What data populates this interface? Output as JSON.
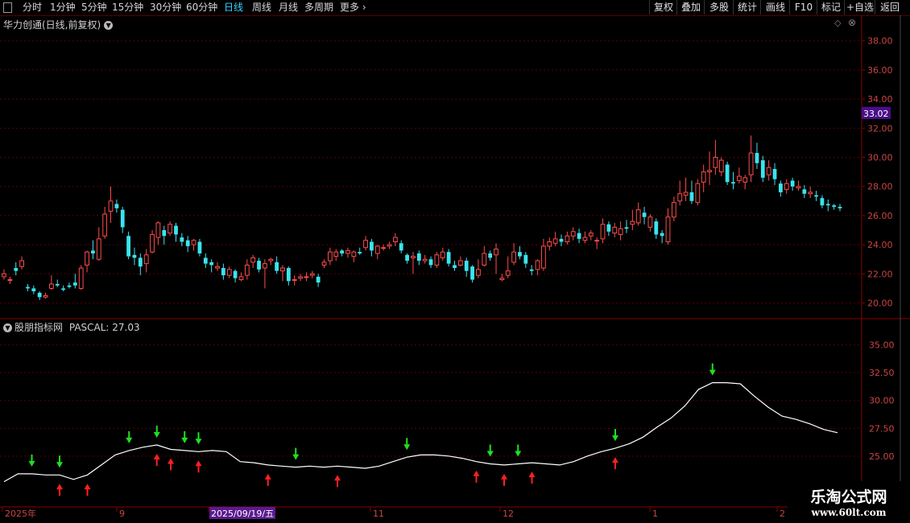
{
  "toolbar": {
    "periods": [
      "分时",
      "1分钟",
      "5分钟",
      "15分钟",
      "30分钟",
      "60分钟",
      "日线",
      "周线",
      "月线",
      "多周期",
      "更多"
    ],
    "active_period": "日线",
    "right_buttons": [
      "复权",
      "叠加",
      "多股",
      "统计",
      "画线",
      "F10",
      "标记",
      "+自选",
      "返回"
    ]
  },
  "main_chart": {
    "title": "华力创通(日线,前复权)",
    "current_price": "33.02",
    "price_ticks": [
      "38.00",
      "36.00",
      "34.00",
      "32.00",
      "30.00",
      "28.00",
      "26.00",
      "24.00",
      "22.00",
      "20.00"
    ],
    "up_color": "#ff4c4c",
    "down_color": "#3ae4ee"
  },
  "indicator": {
    "title": "股朋指标网",
    "value_label": "PASCAL: 27.03",
    "ticks": [
      "35.00",
      "32.50",
      "30.00",
      "27.50",
      "25.00"
    ],
    "line_color": "#ffffff",
    "buy_color": "#ff2020",
    "sell_color": "#20e020"
  },
  "xaxis": {
    "labels": [
      "2025年",
      "9",
      "2025/09/19/五",
      "11",
      "12",
      "1",
      "2"
    ]
  },
  "watermark": {
    "line1": "乐淘公式网",
    "line2": "www.60lt.com"
  },
  "chart_data": {
    "type": "candlestick",
    "price_axis": {
      "range": [
        19.2,
        39.2
      ],
      "ticks": [
        20,
        22,
        24,
        26,
        28,
        30,
        32,
        34,
        36,
        38
      ]
    },
    "indicator_axis": {
      "range": [
        20.5,
        37.0
      ],
      "ticks": [
        25,
        27.5,
        30,
        32.5,
        35
      ]
    },
    "pascal_line": [
      22.7,
      23.4,
      23.4,
      23.3,
      23.3,
      22.9,
      23.3,
      24.2,
      25.1,
      25.5,
      25.8,
      26.0,
      25.6,
      25.5,
      25.4,
      25.5,
      25.4,
      24.5,
      24.4,
      24.2,
      24.1,
      24.0,
      24.1,
      24.0,
      24.1,
      24.0,
      23.9,
      24.1,
      24.5,
      24.9,
      25.1,
      25.1,
      25.0,
      24.8,
      24.5,
      24.3,
      24.2,
      24.3,
      24.4,
      24.3,
      24.2,
      24.5,
      25.0,
      25.4,
      25.7,
      26.1,
      26.7,
      27.6,
      28.4,
      29.5,
      31.0,
      31.6,
      31.6,
      31.5,
      30.4,
      29.4,
      28.6,
      28.3,
      27.9,
      27.4,
      27.1
    ],
    "candles": [
      [
        21.8,
        22.0,
        22.3,
        21.6
      ],
      [
        21.6,
        21.6,
        21.8,
        21.3
      ],
      [
        22.4,
        22.2,
        22.8,
        21.9
      ],
      [
        22.5,
        22.9,
        23.2,
        22.3
      ],
      [
        21.1,
        21.0,
        21.3,
        20.8
      ],
      [
        21.0,
        20.8,
        21.2,
        20.6
      ],
      [
        20.7,
        20.4,
        20.8,
        20.2
      ],
      [
        20.4,
        20.5,
        20.7,
        20.3
      ],
      [
        21.0,
        21.3,
        21.9,
        20.9
      ],
      [
        21.3,
        21.2,
        21.6,
        21.1
      ],
      [
        21.0,
        20.9,
        21.2,
        20.8
      ],
      [
        21.2,
        21.1,
        21.4,
        21.0
      ],
      [
        21.4,
        21.2,
        22.0,
        21.0
      ],
      [
        21.0,
        22.4,
        22.6,
        20.9
      ],
      [
        22.6,
        23.5,
        23.6,
        22.1
      ],
      [
        23.6,
        23.4,
        24.3,
        23.0
      ],
      [
        23.0,
        24.4,
        25.2,
        22.9
      ],
      [
        24.6,
        26.1,
        26.6,
        24.4
      ],
      [
        26.3,
        27.0,
        28.0,
        25.5
      ],
      [
        26.8,
        26.5,
        27.1,
        26.2
      ],
      [
        26.4,
        25.2,
        26.6,
        24.8
      ],
      [
        24.6,
        23.2,
        24.9,
        23.0
      ],
      [
        23.3,
        23.1,
        23.8,
        22.6
      ],
      [
        23.1,
        22.5,
        23.4,
        21.9
      ],
      [
        22.7,
        23.3,
        23.7,
        22.1
      ],
      [
        23.5,
        24.7,
        25.0,
        23.4
      ],
      [
        24.5,
        25.5,
        25.6,
        24.0
      ],
      [
        25.0,
        24.6,
        25.3,
        24.0
      ],
      [
        24.8,
        25.4,
        25.6,
        24.6
      ],
      [
        25.3,
        24.7,
        25.5,
        24.2
      ],
      [
        24.5,
        24.2,
        24.8,
        23.9
      ],
      [
        24.3,
        23.9,
        24.6,
        23.5
      ],
      [
        24.0,
        24.3,
        24.4,
        23.6
      ],
      [
        24.2,
        23.4,
        24.4,
        23.2
      ],
      [
        23.1,
        22.7,
        23.4,
        22.4
      ],
      [
        22.8,
        22.6,
        23.0,
        22.1
      ],
      [
        22.4,
        22.5,
        22.8,
        22.2
      ],
      [
        22.4,
        21.9,
        22.7,
        21.6
      ],
      [
        21.9,
        22.3,
        22.5,
        21.7
      ],
      [
        22.2,
        21.7,
        22.3,
        21.4
      ],
      [
        21.6,
        21.8,
        22.1,
        21.5
      ],
      [
        21.9,
        22.6,
        23.0,
        21.6
      ],
      [
        22.8,
        23.1,
        23.3,
        22.4
      ],
      [
        22.9,
        22.3,
        23.1,
        22.1
      ],
      [
        22.4,
        22.7,
        23.0,
        21.0
      ],
      [
        22.9,
        23.0,
        23.1,
        22.6
      ],
      [
        22.8,
        22.2,
        23.2,
        22.0
      ],
      [
        22.2,
        22.4,
        22.6,
        21.5
      ],
      [
        22.4,
        21.5,
        22.5,
        21.2
      ],
      [
        21.6,
        21.6,
        21.9,
        21.2
      ],
      [
        21.7,
        21.8,
        22.0,
        21.5
      ],
      [
        21.8,
        21.8,
        22.1,
        21.5
      ],
      [
        21.9,
        22.0,
        22.2,
        21.7
      ],
      [
        21.8,
        21.4,
        22.0,
        21.1
      ],
      [
        22.6,
        22.8,
        23.0,
        22.4
      ],
      [
        22.9,
        23.5,
        23.8,
        22.6
      ],
      [
        23.2,
        23.5,
        23.7,
        22.9
      ],
      [
        23.6,
        23.4,
        23.7,
        23.2
      ],
      [
        23.4,
        23.6,
        23.8,
        23.1
      ],
      [
        23.2,
        23.5,
        23.6,
        22.8
      ],
      [
        23.5,
        23.4,
        23.8,
        23.3
      ],
      [
        23.8,
        24.3,
        24.6,
        23.6
      ],
      [
        24.2,
        23.6,
        24.4,
        23.2
      ],
      [
        23.4,
        23.9,
        24.0,
        23.0
      ],
      [
        23.8,
        23.8,
        24.0,
        23.6
      ],
      [
        23.9,
        24.0,
        24.2,
        23.7
      ],
      [
        24.2,
        24.5,
        24.8,
        23.9
      ],
      [
        24.1,
        23.6,
        24.3,
        23.4
      ],
      [
        23.3,
        22.9,
        23.4,
        22.7
      ],
      [
        23.1,
        23.2,
        23.5,
        22.0
      ],
      [
        23.4,
        22.9,
        23.6,
        22.6
      ],
      [
        22.9,
        23.0,
        23.3,
        22.7
      ],
      [
        23.0,
        22.6,
        23.2,
        22.4
      ],
      [
        22.6,
        23.3,
        23.5,
        22.4
      ],
      [
        23.1,
        23.5,
        23.8,
        22.9
      ],
      [
        23.5,
        22.7,
        23.7,
        22.5
      ],
      [
        22.6,
        22.4,
        22.9,
        22.2
      ],
      [
        22.6,
        22.9,
        23.2,
        22.5
      ],
      [
        22.9,
        22.2,
        23.1,
        21.8
      ],
      [
        22.5,
        21.6,
        22.6,
        21.4
      ],
      [
        21.9,
        22.3,
        23.0,
        21.7
      ],
      [
        22.6,
        23.4,
        23.9,
        22.5
      ],
      [
        23.4,
        23.1,
        23.6,
        22.9
      ],
      [
        23.3,
        23.7,
        24.1,
        22.0
      ],
      [
        21.6,
        21.7,
        22.0,
        21.5
      ],
      [
        21.9,
        22.2,
        23.2,
        21.7
      ],
      [
        22.8,
        23.5,
        24.1,
        22.6
      ],
      [
        23.5,
        23.2,
        23.9,
        23.0
      ],
      [
        23.3,
        22.7,
        23.5,
        22.4
      ],
      [
        22.3,
        22.2,
        22.6,
        21.9
      ],
      [
        22.3,
        22.9,
        23.0,
        21.9
      ],
      [
        22.4,
        23.9,
        24.4,
        22.2
      ],
      [
        23.9,
        24.2,
        24.5,
        23.6
      ],
      [
        24.1,
        24.4,
        24.9,
        23.9
      ],
      [
        24.4,
        24.2,
        24.7,
        23.9
      ],
      [
        24.2,
        24.6,
        24.9,
        24.0
      ],
      [
        24.6,
        24.9,
        25.2,
        24.3
      ],
      [
        24.8,
        24.4,
        25.1,
        24.1
      ],
      [
        24.3,
        24.5,
        24.9,
        24.1
      ],
      [
        24.6,
        24.8,
        25.0,
        24.3
      ],
      [
        24.3,
        24.3,
        24.5,
        23.7
      ],
      [
        24.4,
        25.4,
        25.8,
        24.1
      ],
      [
        25.4,
        24.9,
        25.6,
        24.6
      ],
      [
        24.8,
        25.2,
        25.5,
        24.5
      ],
      [
        24.7,
        25.1,
        25.6,
        24.3
      ],
      [
        25.2,
        25.1,
        25.7,
        24.8
      ],
      [
        25.4,
        25.6,
        26.4,
        25.0
      ],
      [
        25.5,
        26.4,
        26.9,
        25.3
      ],
      [
        26.2,
        25.9,
        26.6,
        25.4
      ],
      [
        25.2,
        25.9,
        26.1,
        24.9
      ],
      [
        25.6,
        24.7,
        25.8,
        24.4
      ],
      [
        24.8,
        24.6,
        25.0,
        24.1
      ],
      [
        24.2,
        25.9,
        26.5,
        24.0
      ],
      [
        25.9,
        26.9,
        27.3,
        25.6
      ],
      [
        27.0,
        27.5,
        28.4,
        26.7
      ],
      [
        27.4,
        27.6,
        28.6,
        27.0
      ],
      [
        27.6,
        27.0,
        28.4,
        26.8
      ],
      [
        26.9,
        28.2,
        28.5,
        26.7
      ],
      [
        28.3,
        29.0,
        29.5,
        27.6
      ],
      [
        29.0,
        29.1,
        30.4,
        28.1
      ],
      [
        29.3,
        30.0,
        31.2,
        28.8
      ],
      [
        29.0,
        29.8,
        30.0,
        28.7
      ],
      [
        29.5,
        28.3,
        29.7,
        28.1
      ],
      [
        28.3,
        28.2,
        29.0,
        27.8
      ],
      [
        28.4,
        28.7,
        29.3,
        28.2
      ],
      [
        28.3,
        28.6,
        28.8,
        27.8
      ],
      [
        28.8,
        30.3,
        31.5,
        28.3
      ],
      [
        30.3,
        29.6,
        31.0,
        29.2
      ],
      [
        29.8,
        28.6,
        30.1,
        28.3
      ],
      [
        28.8,
        29.3,
        29.8,
        28.4
      ],
      [
        29.2,
        28.5,
        29.6,
        28.1
      ],
      [
        28.2,
        27.6,
        28.4,
        27.3
      ],
      [
        27.8,
        28.2,
        28.5,
        27.5
      ],
      [
        28.4,
        28.0,
        28.6,
        27.7
      ],
      [
        27.9,
        28.0,
        28.4,
        27.7
      ],
      [
        27.8,
        27.5,
        28.1,
        27.2
      ],
      [
        27.5,
        27.6,
        28.0,
        27.2
      ],
      [
        27.4,
        27.3,
        27.7,
        27.0
      ],
      [
        27.2,
        26.7,
        27.4,
        26.5
      ],
      [
        26.8,
        26.7,
        27.1,
        26.3
      ],
      [
        26.7,
        26.6,
        26.8,
        26.4
      ],
      [
        26.6,
        26.5,
        26.8,
        26.3
      ]
    ]
  }
}
